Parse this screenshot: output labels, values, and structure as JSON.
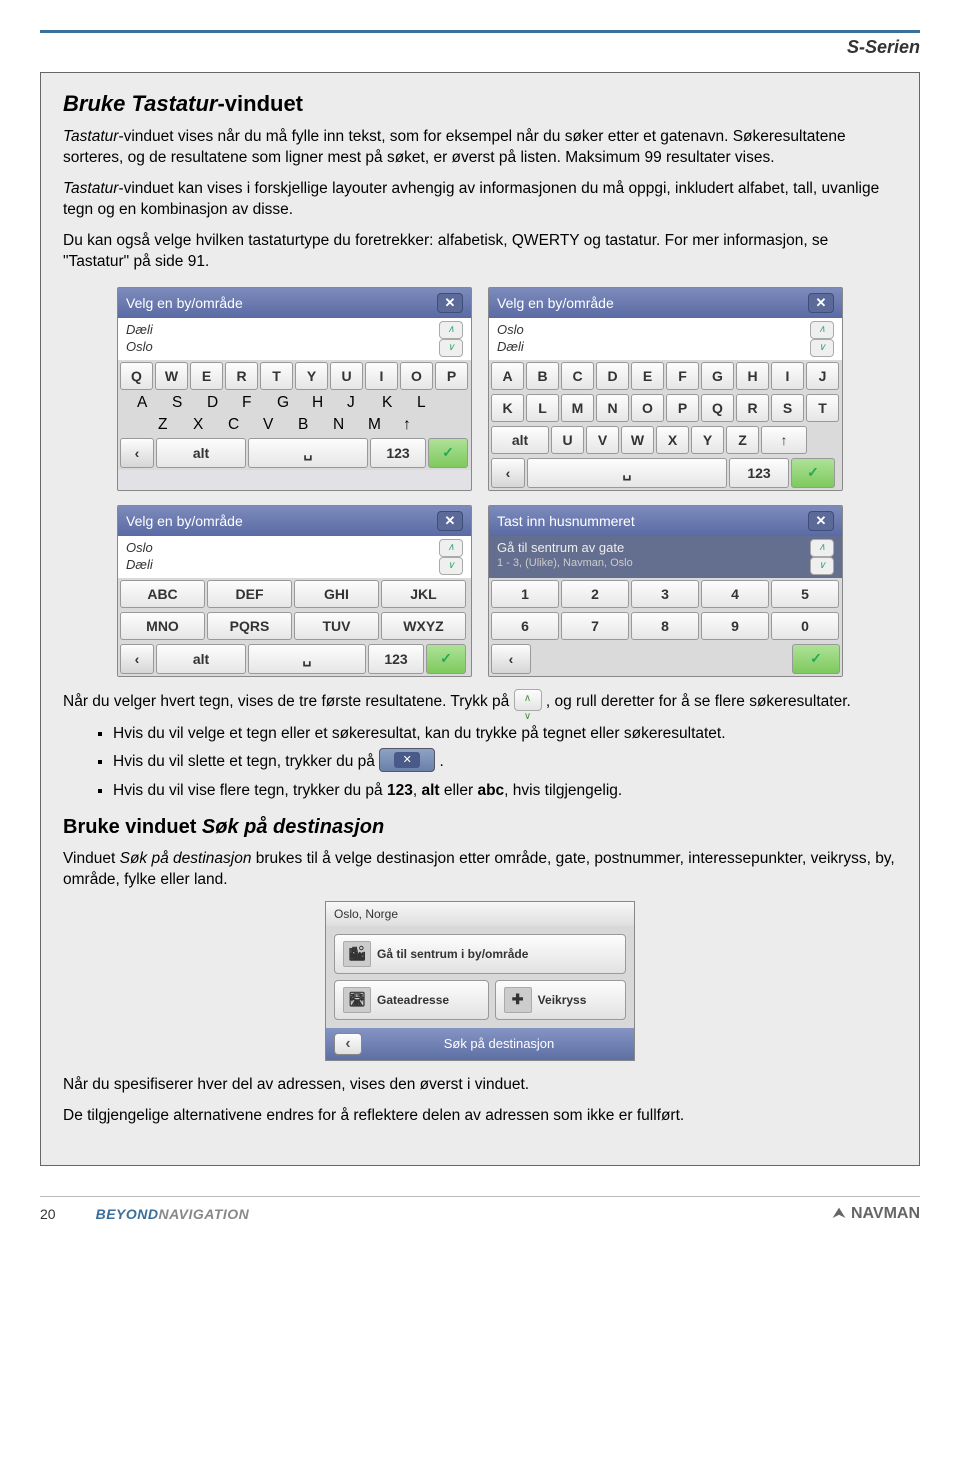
{
  "header": {
    "series": "S-Serien"
  },
  "section1": {
    "title_ital": "Bruke Tastatur",
    "title_reg": "-vinduet",
    "p1a": "Tastatur",
    "p1b": "-vinduet vises når du må fylle inn tekst, som for eksempel når du søker etter et gatenavn. Søkeresultatene sorteres, og de resultatene som ligner mest på søket, er øverst på listen. Maksimum 99 resultater vises.",
    "p2a": "Tastatur",
    "p2b": "-vinduet kan vises i forskjellige layouter avhengig av informasjonen du må oppgi, inkludert alfabet, tall, uvanlige tegn og en kombinasjon av disse.",
    "p3": "Du kan også velge hvilken tastaturtype du foretrekker: alfabetisk, QWERTY og tastatur. For mer informasjon, se \"Tastatur\" på side 91."
  },
  "screens": {
    "qwerty": {
      "header": "Velg en by/område",
      "items": [
        "Dæli",
        "Oslo"
      ],
      "row1": [
        "Q",
        "W",
        "E",
        "R",
        "T",
        "Y",
        "U",
        "I",
        "O",
        "P"
      ],
      "row2": [
        "A",
        "S",
        "D",
        "F",
        "G",
        "H",
        "J",
        "K",
        "L"
      ],
      "row3": [
        "Z",
        "X",
        "C",
        "V",
        "B",
        "N",
        "M",
        "↑"
      ],
      "bottom": [
        "‹",
        "alt",
        "␣",
        "123",
        "✓"
      ]
    },
    "abc": {
      "header": "Velg en by/område",
      "items": [
        "Oslo",
        "Dæli"
      ],
      "row1": [
        "A",
        "B",
        "C",
        "D",
        "E",
        "F",
        "G",
        "H",
        "I",
        "J"
      ],
      "row2": [
        "K",
        "L",
        "M",
        "N",
        "O",
        "P",
        "Q",
        "R",
        "S",
        "T"
      ],
      "row3": [
        "alt",
        "U",
        "V",
        "W",
        "X",
        "Y",
        "Z",
        "↑"
      ],
      "bottom": [
        "‹",
        "␣",
        "123",
        "✓"
      ]
    },
    "t9": {
      "header": "Velg en by/område",
      "items": [
        "Oslo",
        "Dæli"
      ],
      "row1": [
        "ABC",
        "DEF",
        "GHI",
        "JKL"
      ],
      "row2": [
        "MNO",
        "PQRS",
        "TUV",
        "WXYZ"
      ],
      "bottom": [
        "‹",
        "alt",
        "␣",
        "123",
        "✓"
      ]
    },
    "num": {
      "header": "Tast inn husnummeret",
      "subtitle": "Gå til sentrum av gate",
      "subinfo": "1 - 3, (Ulike), Navman, Oslo",
      "row1": [
        "1",
        "2",
        "3",
        "4",
        "5"
      ],
      "row2": [
        "6",
        "7",
        "8",
        "9",
        "0"
      ],
      "bottom": [
        "‹",
        "✓"
      ]
    }
  },
  "after": {
    "t1": "Når du velger hvert tegn, vises de tre første resultatene. Trykk på ",
    "t2": ", og rull deretter for å se flere søkeresultater.",
    "b1": "Hvis du vil velge et tegn eller et søkeresultat, kan du trykke på tegnet eller søkeresultatet.",
    "b2a": "Hvis du vil slette et tegn, trykker du på ",
    "b2b": ".",
    "b3a": "Hvis du vil vise flere tegn, trykker du på ",
    "b3_123": "123",
    "b3_sep": ", ",
    "b3_alt": "alt",
    "b3_or": " eller ",
    "b3_abc": "abc",
    "b3b": ", hvis tilgjengelig."
  },
  "section2": {
    "title_reg": "Bruke vinduet ",
    "title_ital": "Søk på destinasjon",
    "p1a": "Vinduet ",
    "p1b": "Søk på destinasjon",
    "p1c": " brukes til å velge destinasjon etter område, gate, postnummer, interessepunkter, veikryss, by, område, fylke eller land."
  },
  "dest": {
    "hdr": "Oslo, Norge",
    "btn1": "Gå til sentrum i by/område",
    "btn2": "Gateadresse",
    "btn3": "Veikryss",
    "foot": "Søk på destinasjon"
  },
  "closing": {
    "p1": "Når du spesifiserer hver del av adressen, vises den øverst i vinduet.",
    "p2": "De tilgjengelige alternativene endres for å reflektere delen av adressen som ikke er fullført."
  },
  "footer": {
    "page": "20",
    "brand1a": "BEYOND",
    "brand1b": "NAVIGATION",
    "brand2": "NAVMAN"
  }
}
